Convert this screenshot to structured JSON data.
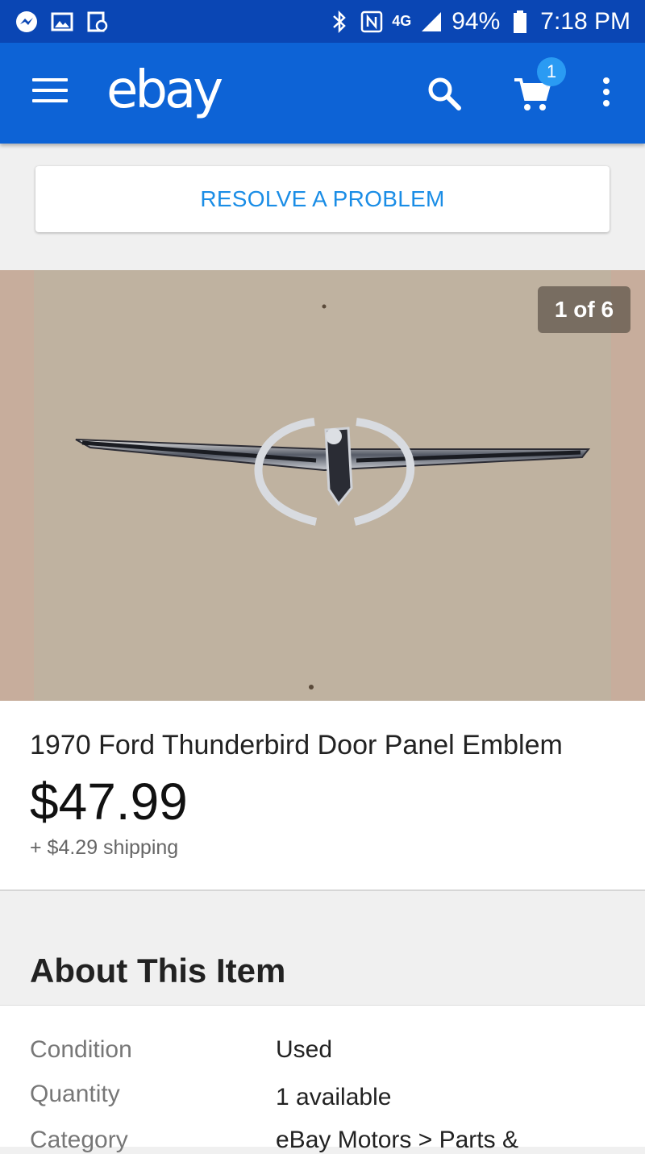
{
  "status_bar": {
    "network": "4G",
    "battery": "94%",
    "time": "7:18 PM",
    "icons": [
      "messenger-icon",
      "gallery-icon",
      "sync-icon",
      "bluetooth-icon",
      "nfc-icon",
      "signal-icon",
      "battery-icon"
    ]
  },
  "app_bar": {
    "logo": "ebay",
    "cart_count": "1",
    "icons": [
      "menu-icon",
      "search-icon",
      "cart-icon",
      "more-vert-icon"
    ],
    "color": "#0d63d6"
  },
  "resolve": {
    "label": "RESOLVE A PROBLEM"
  },
  "gallery": {
    "counter": "1 of 6"
  },
  "item": {
    "title": "1970 Ford Thunderbird Door Panel Emblem",
    "price": "$47.99",
    "shipping": "+ $4.29 shipping"
  },
  "about": {
    "title": "About This Item",
    "rows": [
      {
        "label": "Condition",
        "value": "Used"
      },
      {
        "label": "Quantity",
        "value": "1 available"
      },
      {
        "label": "Category",
        "value": "eBay Motors > Parts &"
      }
    ]
  }
}
